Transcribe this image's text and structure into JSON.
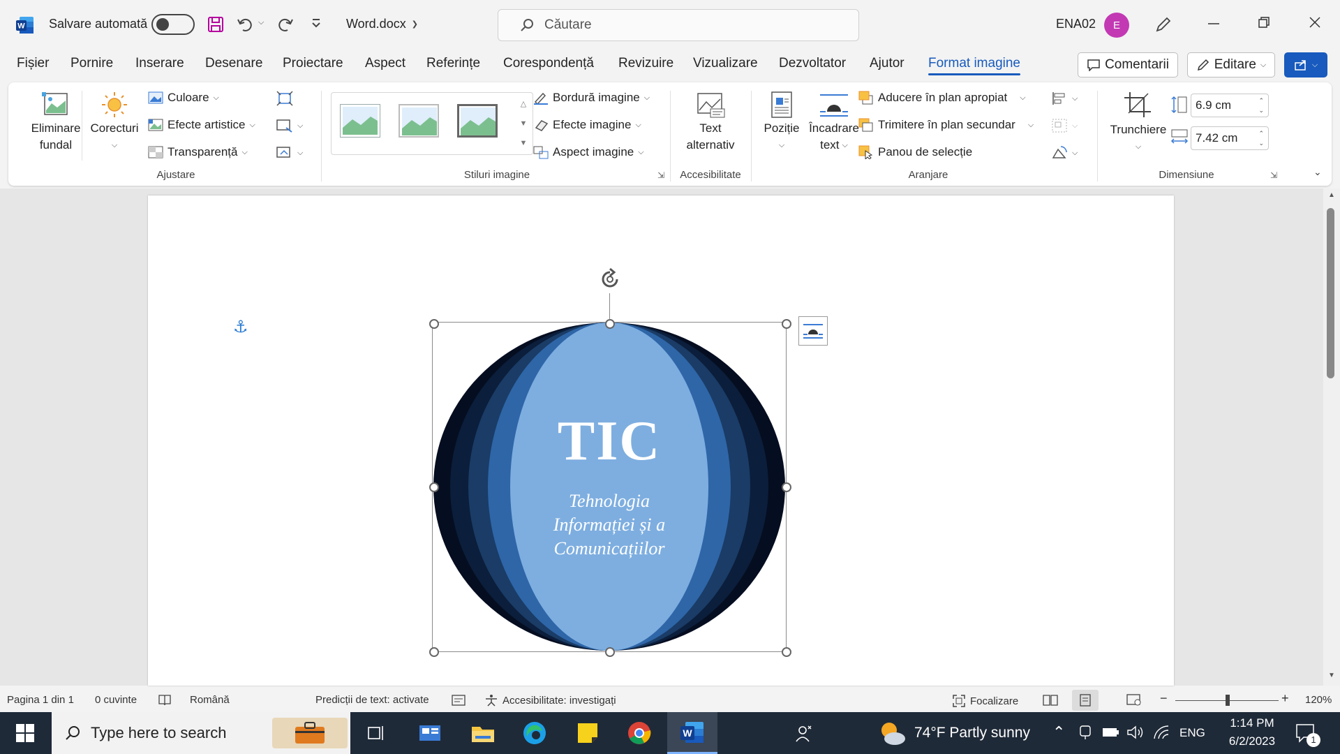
{
  "titlebar": {
    "autosave_label": "Salvare automată",
    "filename": "Word.docx",
    "search_placeholder": "Căutare",
    "user_name": "ENA02",
    "user_initial": "E"
  },
  "menu": {
    "tabs": [
      "Fișier",
      "Pornire",
      "Inserare",
      "Desenare",
      "Proiectare",
      "Aspect",
      "Referințe",
      "Corespondență",
      "Revizuire",
      "Vizualizare",
      "Dezvoltator",
      "Ajutor",
      "Format imagine"
    ],
    "active_tab": "Format imagine",
    "comments_label": "Comentarii",
    "editing_label": "Editare"
  },
  "ribbon": {
    "ajustare": {
      "remove_bg_line1": "Eliminare",
      "remove_bg_line2": "fundal",
      "corrections": "Corecturi",
      "color": "Culoare",
      "artistic_effects": "Efecte artistice",
      "transparency": "Transparență",
      "group_label": "Ajustare"
    },
    "stiluri": {
      "border": "Bordură imagine",
      "effects": "Efecte imagine",
      "layout": "Aspect imagine",
      "group_label": "Stiluri imagine"
    },
    "accesibilitate": {
      "alt_text_line1": "Text",
      "alt_text_line2": "alternativ",
      "group_label": "Accesibilitate"
    },
    "aranjare": {
      "position": "Poziție",
      "wrap_line1": "Încadrare",
      "wrap_line2": "text",
      "bring_forward": "Aducere în plan apropiat",
      "send_backward": "Trimitere în plan secundar",
      "selection_pane": "Panou de selecție",
      "group_label": "Aranjare"
    },
    "dimensiune": {
      "crop": "Trunchiere",
      "height": "6.9 cm",
      "width": "7.42 cm",
      "group_label": "Dimensiune"
    }
  },
  "document": {
    "image_title": "TIC",
    "image_line1": "Tehnologia",
    "image_line2": "Informației și a",
    "image_line3": "Comunicațiilor"
  },
  "statusbar": {
    "page": "Pagina 1 din 1",
    "words": "0 cuvinte",
    "language": "Română",
    "predictions": "Predicții de text: activate",
    "accessibility": "Accesibilitate: investigați",
    "focus": "Focalizare",
    "zoom": "120%"
  },
  "taskbar": {
    "search_placeholder": "Type here to search",
    "weather": "74°F  Partly sunny",
    "lang": "ENG",
    "time": "1:14 PM",
    "date": "6/2/2023",
    "notifications": "1"
  }
}
